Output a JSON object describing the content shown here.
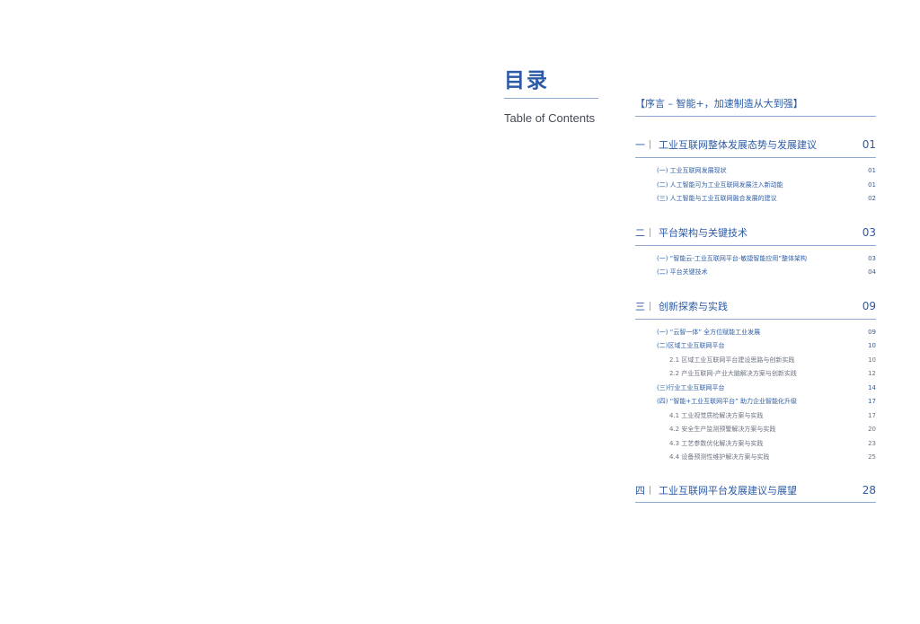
{
  "heading": {
    "title": "目录",
    "subtitle": "Table of Contents"
  },
  "preface": "【序言 – 智能+，加速制造从大到强】",
  "sections": [
    {
      "num": "一",
      "title": "工业互联网整体发展态势与发展建议",
      "page": "01",
      "entries": [
        {
          "text": "(一) 工业互联网发展现状",
          "page": "01"
        },
        {
          "text": "(二) 人工智能可为工业互联网发展注入新动能",
          "page": "01"
        },
        {
          "text": "(三) 人工智能与工业互联网融合发展的建议",
          "page": "02"
        }
      ]
    },
    {
      "num": "二",
      "title": "平台架构与关键技术",
      "page": "03",
      "entries": [
        {
          "text": "(一) “智能云-工业互联网平台-敏捷智能应用”整体架构",
          "page": "03"
        },
        {
          "text": "(二) 平台关键技术",
          "page": "04"
        }
      ]
    },
    {
      "num": "三",
      "title": "创新探索与实践",
      "page": "09",
      "entries": [
        {
          "text": "(一) “云智一体” 全方位赋能工业发展",
          "page": "09"
        },
        {
          "text": "(二)区域工业互联网平台",
          "page": "10"
        },
        {
          "text": "2.1 区域工业互联网平台建设思路与创新实践",
          "page": "10",
          "sub": true
        },
        {
          "text": "2.2 产业互联网-产业大脑解决方案与创新实践",
          "page": "12",
          "sub": true
        },
        {
          "text": "(三)行业工业互联网平台",
          "page": "14"
        },
        {
          "text": "(四) “智能+工业互联网平台” 助力企业智能化升级",
          "page": "17"
        },
        {
          "text": "4.1 工业视觉质检解决方案与实践",
          "page": "17",
          "sub": true
        },
        {
          "text": "4.2 安全生产监测预警解决方案与实践",
          "page": "20",
          "sub": true
        },
        {
          "text": "4.3 工艺参数优化解决方案与实践",
          "page": "23",
          "sub": true
        },
        {
          "text": "4.4 设备预测性维护解决方案与实践",
          "page": "25",
          "sub": true
        }
      ]
    },
    {
      "num": "四",
      "title": "工业互联网平台发展建议与展望",
      "page": "28",
      "entries": []
    }
  ],
  "colors": {
    "accent": "#2b5ba6",
    "rule": "#8fa9d0",
    "subtitle": "#444a55"
  }
}
